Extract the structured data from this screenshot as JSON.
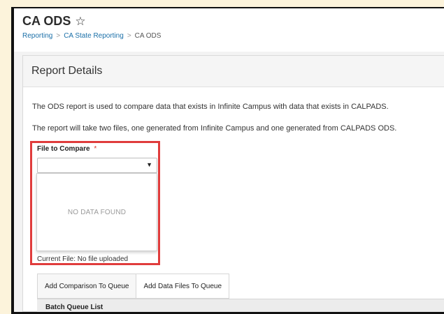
{
  "header": {
    "title": "CA ODS",
    "favorite_icon": "star-outline-icon",
    "breadcrumb": [
      "Reporting",
      "CA State Reporting",
      "CA ODS"
    ]
  },
  "panel": {
    "title": "Report Details",
    "description_1": "The ODS report is used to compare data that exists in Infinite Campus with data that exists in CALPADS.",
    "description_2": "The report will take two files, one generated from Infinite Campus and one generated from CALPADS ODS."
  },
  "file_select": {
    "label": "File to Compare",
    "required_mark": "*",
    "value": "",
    "empty_message": "NO DATA FOUND",
    "current_file": "Current File: No file uploaded"
  },
  "tabs": [
    "Add Comparison To Queue",
    "Add Data Files To Queue"
  ],
  "batch": {
    "title": "Batch Queue List"
  },
  "colors": {
    "background": "#fcf3db",
    "highlight": "#e03c3c",
    "link": "#1a6fa8",
    "required": "#d9342b"
  }
}
